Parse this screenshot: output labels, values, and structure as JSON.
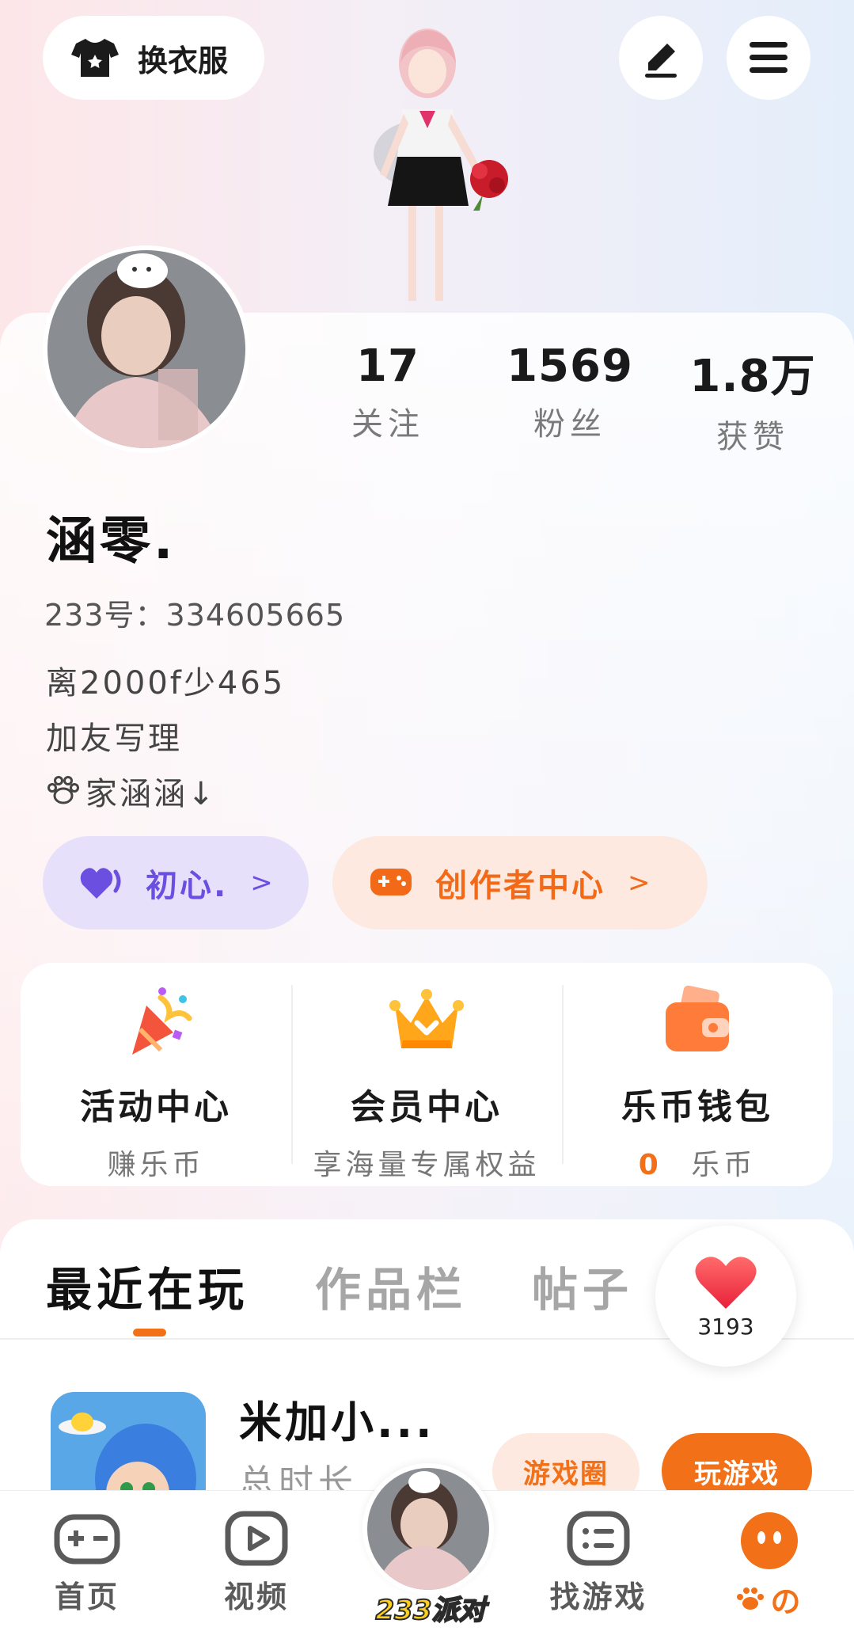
{
  "header": {
    "outfit_button": "换衣服",
    "edit_icon": "pen-icon",
    "menu_icon": "hamburger-menu-icon"
  },
  "profile": {
    "stats": [
      {
        "value": "17",
        "label": "关注"
      },
      {
        "value": "1569",
        "label": "粉丝"
      },
      {
        "value": "1.8万",
        "label": "获赞"
      }
    ],
    "nickname": "涵零.",
    "uid": "233号：334605665",
    "bio": [
      "离2000f少465",
      "加友写理",
      "家涵涵↓"
    ],
    "badge_label": "初心.",
    "creator_label": "创作者中心",
    "chevron": ">"
  },
  "features": [
    {
      "title": "活动中心",
      "subtitle": "赚乐币",
      "icon": "party-popper-icon"
    },
    {
      "title": "会员中心",
      "subtitle": "享海量专属权益",
      "icon": "crown-icon"
    },
    {
      "title": "乐币钱包",
      "amount": "0",
      "unit": "乐币",
      "icon": "wallet-icon"
    }
  ],
  "tabs": [
    {
      "label": "最近在玩",
      "active": true
    },
    {
      "label": "作品栏",
      "active": false
    },
    {
      "label": "帖子",
      "active": false
    }
  ],
  "likes": {
    "count": "3193"
  },
  "recent_game": {
    "title": "米加小...",
    "subtitle": "总时长",
    "circle_button": "游戏圈",
    "play_button": "玩游戏"
  },
  "bottom_nav": [
    {
      "label": "首页",
      "icon": "gamepad-icon"
    },
    {
      "label": "视频",
      "icon": "video-play-icon"
    },
    {
      "label": "233派对",
      "icon": "party-avatar"
    },
    {
      "label": "找游戏",
      "icon": "list-icon"
    },
    {
      "label": "の",
      "icon": "me-face-icon"
    }
  ],
  "colors": {
    "accent_orange": "#f27118",
    "accent_purple": "#6a4fe0"
  }
}
